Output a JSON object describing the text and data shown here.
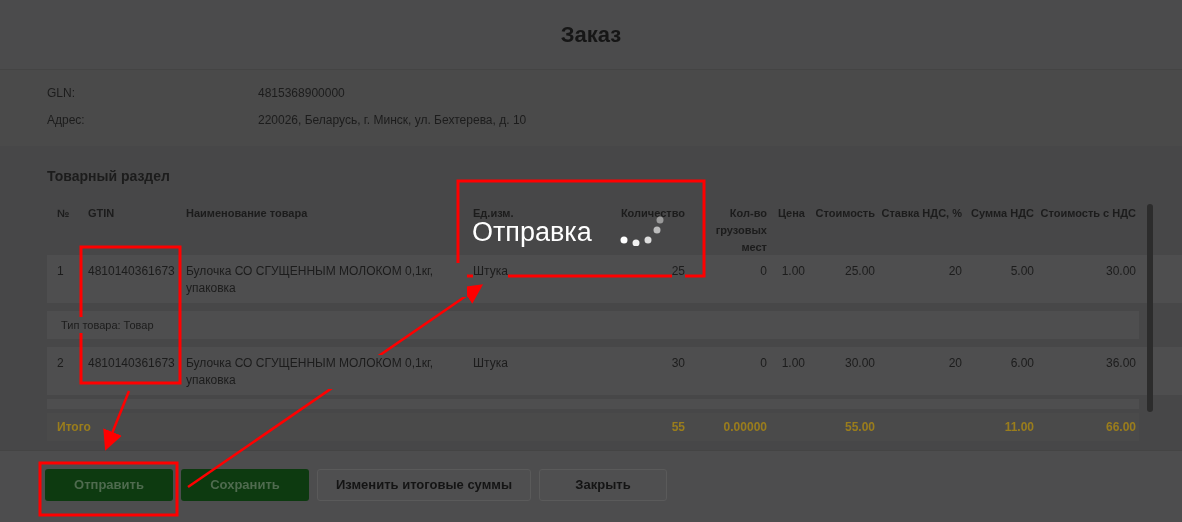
{
  "window": {
    "title": "Заказ"
  },
  "fields": [
    {
      "label": "GLN:",
      "value": "4815368900000"
    },
    {
      "label": "Адрес:",
      "value": "220026, Беларусь, г. Минск, ул. Бехтерева, д. 10"
    }
  ],
  "table": {
    "title": "Товарный раздел",
    "columns": [
      "№",
      "GTIN",
      "Наименование товара",
      "Ед.изм.",
      "Количество",
      "Кол-во грузовых мест",
      "Цена",
      "Стоимость",
      "Ставка НДС, %",
      "Сумма НДС",
      "Стоимость с НДС"
    ],
    "rows": [
      {
        "cells": [
          "1",
          "4810140361673",
          "Булочка СО СГУЩЕННЫМ МОЛОКОМ 0,1кг, упаковка",
          "Штука",
          "25",
          "0",
          "1.00",
          "25.00",
          "20",
          "5.00",
          "30.00"
        ],
        "note": "Тип товара: Товар"
      },
      {
        "cells": [
          "2",
          "4810140361673",
          "Булочка СО СГУЩЕННЫМ МОЛОКОМ 0,1кг, упаковка",
          "Штука",
          "30",
          "0",
          "1.00",
          "30.00",
          "20",
          "6.00",
          "36.00"
        ],
        "note": null
      }
    ],
    "totals": {
      "label": "Итого",
      "quantity": "55",
      "places": "0.00000",
      "cost": "55.00",
      "vat_sum": "11.00",
      "total": "66.00"
    }
  },
  "loading": {
    "text": "Отправка"
  },
  "buttons": [
    {
      "label": "Отправить",
      "kind": "primary"
    },
    {
      "label": "Сохранить",
      "kind": "primary"
    },
    {
      "label": "Изменить итоговые суммы",
      "kind": "secondary"
    },
    {
      "label": "Закрыть",
      "kind": "secondary"
    }
  ]
}
